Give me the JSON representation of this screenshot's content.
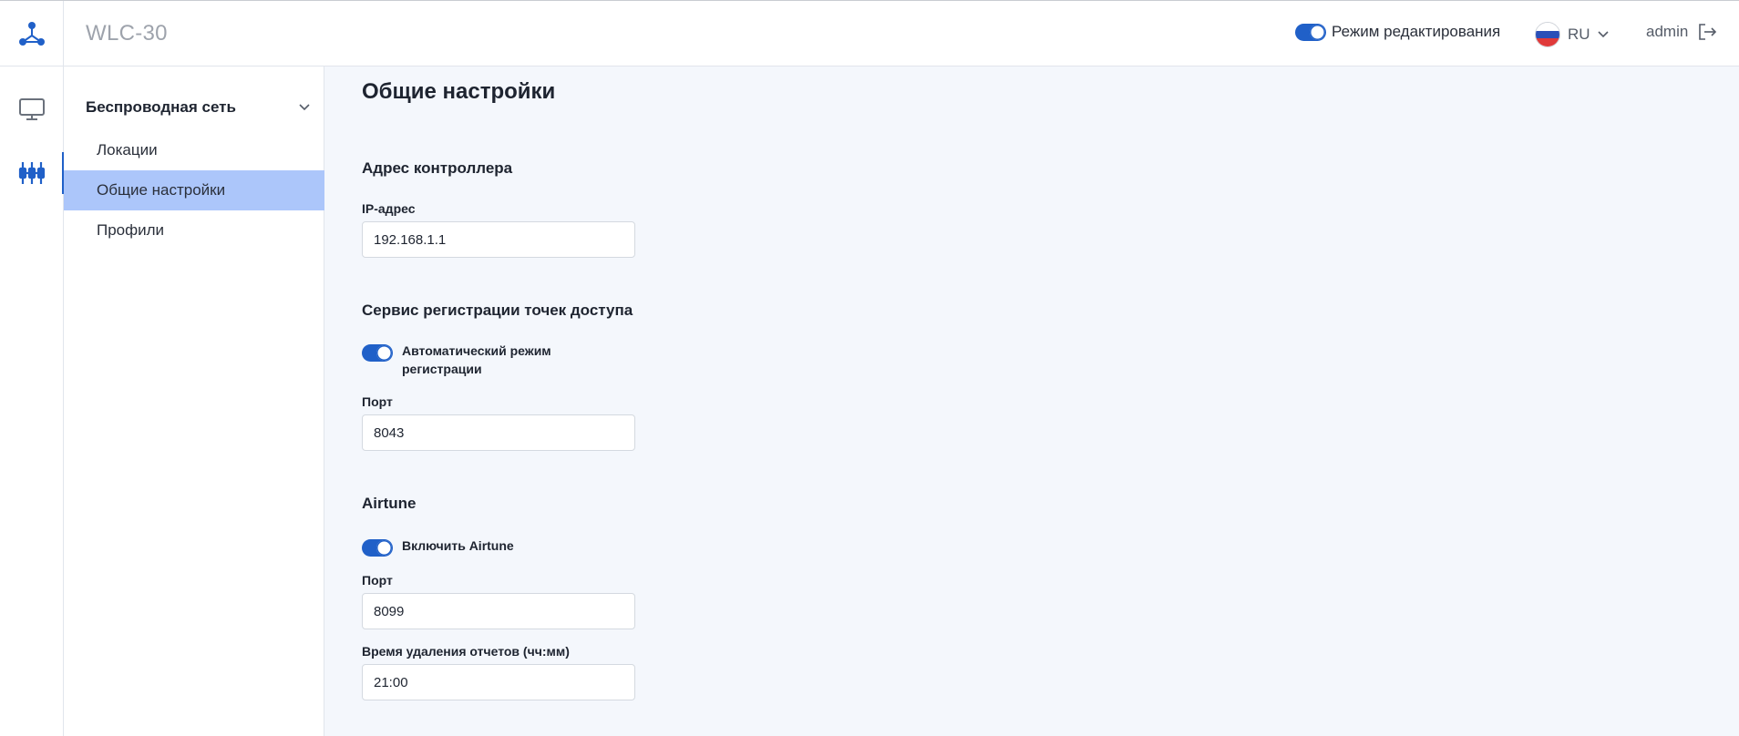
{
  "header": {
    "app_title": "WLC-30",
    "edit_mode_label": "Режим редактирования",
    "edit_mode_on": true,
    "language": "RU",
    "username": "admin"
  },
  "icons": {
    "logo": "network-nodes-icon",
    "rail": [
      "monitor-icon",
      "sliders-icon"
    ],
    "lang_chevron": "chevron-down-icon",
    "logout": "logout-icon",
    "group_chevron": "chevron-down-icon"
  },
  "colors": {
    "accent": "#2060c8",
    "selected_nav": "#acc6fa",
    "background": "#f4f7fc"
  },
  "subnav": {
    "group_label": "Беспроводная сеть",
    "items": [
      {
        "label": "Локации",
        "selected": false
      },
      {
        "label": "Общие настройки",
        "selected": true
      },
      {
        "label": "Профили",
        "selected": false
      }
    ]
  },
  "page": {
    "title": "Общие настройки",
    "controller": {
      "section_title": "Адрес контроллера",
      "ip_label": "IP-адрес",
      "ip_value": "192.168.1.1"
    },
    "registration": {
      "section_title": "Сервис регистрации точек доступа",
      "auto_label": "Автоматический режим регистрации",
      "auto_on": true,
      "port_label": "Порт",
      "port_value": "8043"
    },
    "airtune": {
      "section_title": "Airtune",
      "enable_label": "Включить Airtune",
      "enable_on": true,
      "port_label": "Порт",
      "port_value": "8099",
      "report_time_label": "Время удаления отчетов (чч:мм)",
      "report_time_value": "21:00"
    }
  }
}
